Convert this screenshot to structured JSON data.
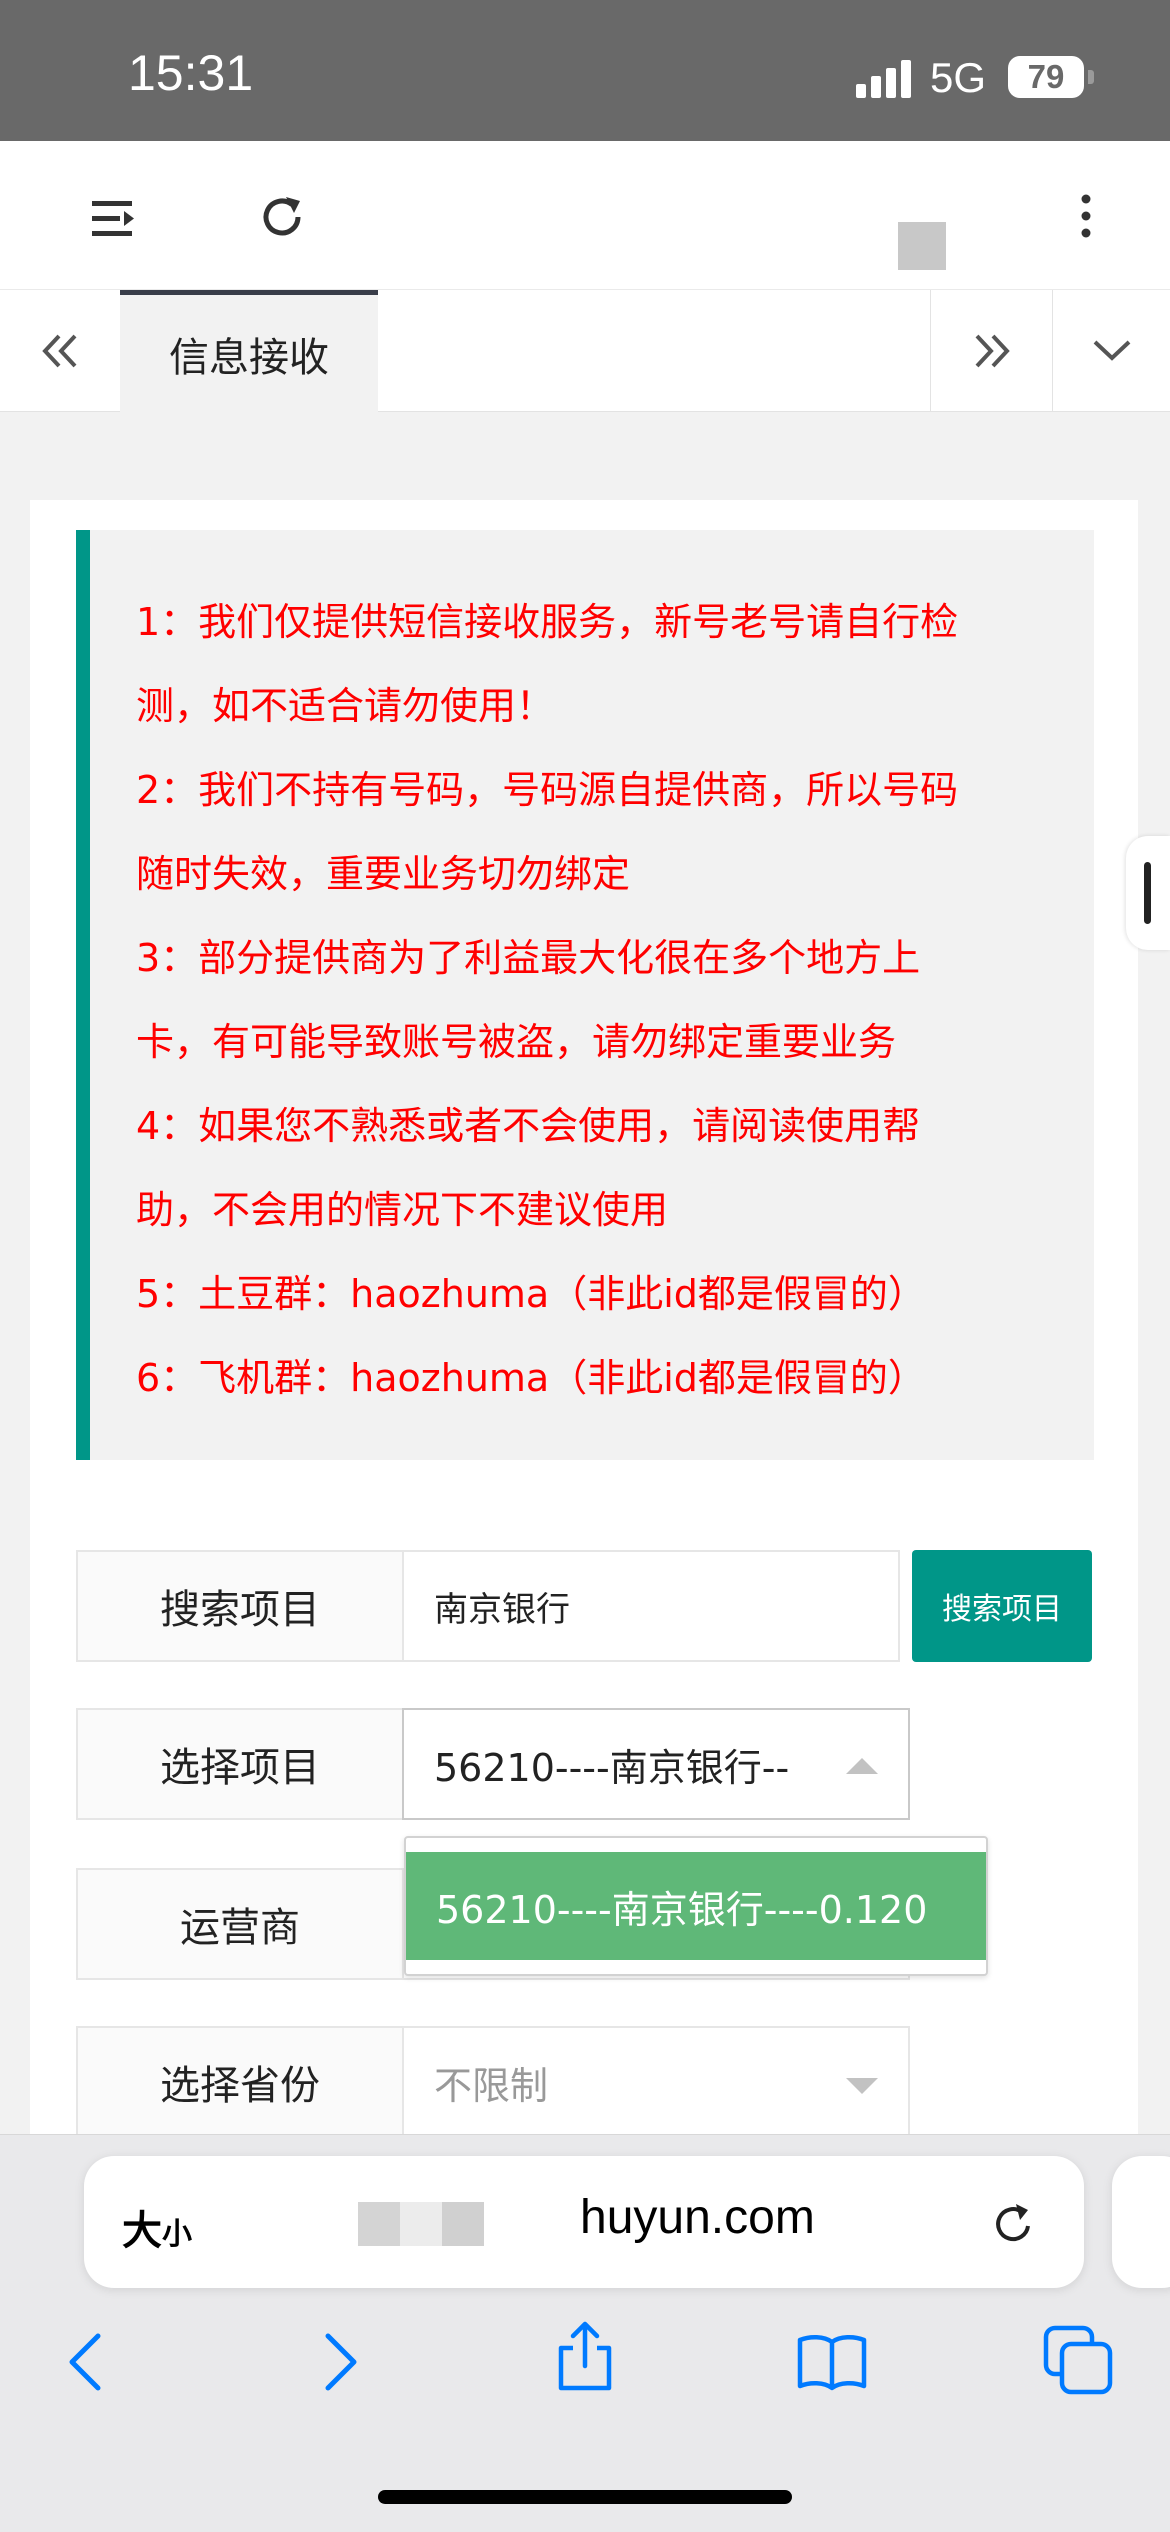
{
  "status_bar": {
    "time": "15:31",
    "network": "5G",
    "battery": "79"
  },
  "tabs": {
    "active_label": "信息接收"
  },
  "notice": {
    "lines": [
      "1：我们仅提供短信接收服务，新号老号请自行检",
      "测，如不适合请勿使用！",
      "2：我们不持有号码，号码源自提供商，所以号码",
      "随时失效，重要业务切勿绑定",
      "3：部分提供商为了利益最大化很在多个地方上",
      "卡，有可能导致账号被盗，请勿绑定重要业务",
      "4：如果您不熟悉或者不会使用，请阅读使用帮",
      "助，不会用的情况下不建议使用",
      "5：土豆群：haozhuma（非此id都是假冒的）",
      "6：飞机群：haozhuma（非此id都是假冒的）"
    ]
  },
  "form": {
    "search_label": "搜索项目",
    "search_value": "南京银行",
    "search_button": "搜索项目",
    "project_label": "选择项目",
    "project_value": "56210----南京银行--",
    "project_options": [
      "56210----南京银行----0.120"
    ],
    "carrier_label": "运营商",
    "province_label": "选择省份",
    "province_value": "不限制"
  },
  "browser": {
    "text_size": "大",
    "text_size_small": "小",
    "url": "huyun.com"
  },
  "colors": {
    "accent": "#009688",
    "notice_text": "#ff0000",
    "option_bg": "#5fb878"
  }
}
